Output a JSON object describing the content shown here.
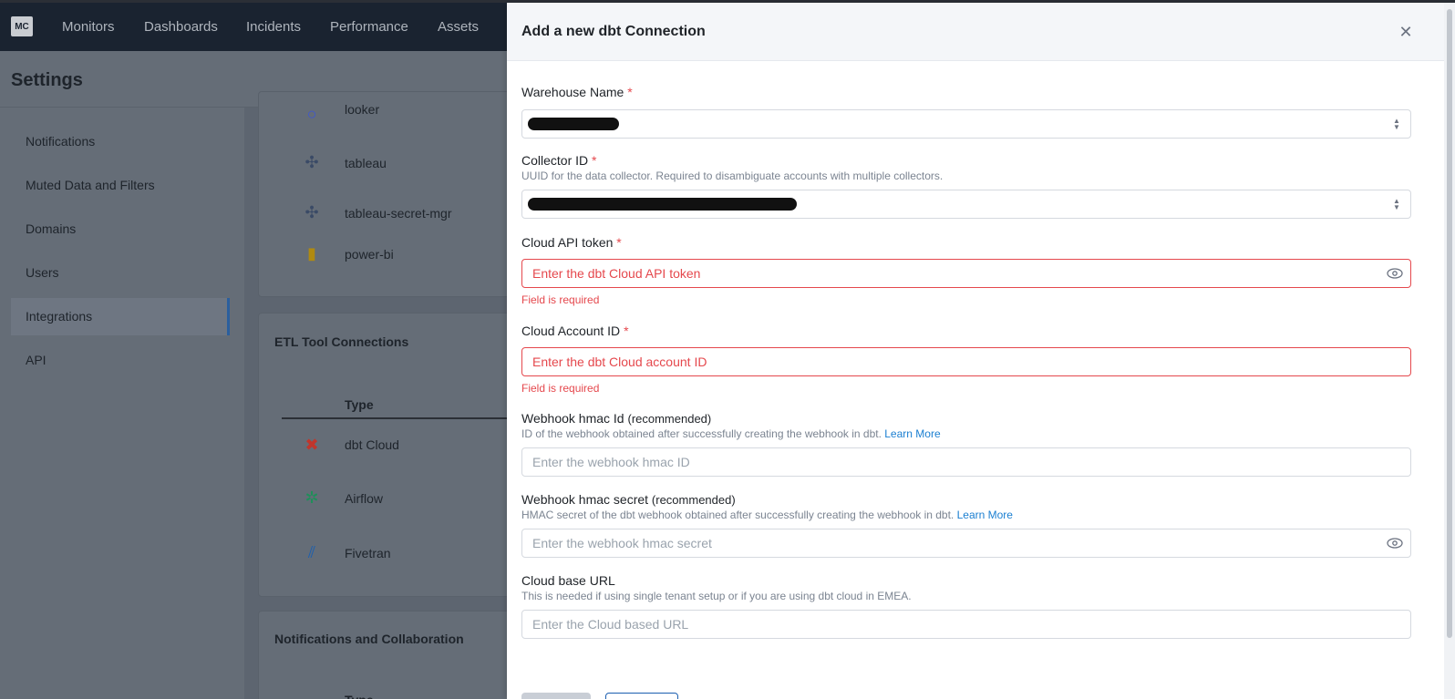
{
  "app": {
    "logo": "MC",
    "nav": [
      "Monitors",
      "Dashboards",
      "Incidents",
      "Performance",
      "Assets"
    ],
    "page_title": "Settings"
  },
  "sidebar": {
    "items": [
      "Notifications",
      "Muted Data and Filters",
      "Domains",
      "Users",
      "Integrations",
      "API"
    ],
    "active": "Integrations"
  },
  "bi_rows": [
    {
      "name": "looker",
      "icon": "looker-icon"
    },
    {
      "name": "tableau",
      "icon": "tableau-icon"
    },
    {
      "name": "tableau-secret-mgr",
      "icon": "tableau-icon"
    },
    {
      "name": "power-bi",
      "icon": "power-bi-icon"
    }
  ],
  "etl": {
    "title": "ETL Tool Connections",
    "column_type": "Type",
    "rows": [
      {
        "name": "dbt Cloud",
        "icon": "dbt-icon"
      },
      {
        "name": "Airflow",
        "icon": "airflow-icon"
      },
      {
        "name": "Fivetran",
        "icon": "fivetran-icon"
      }
    ]
  },
  "notifications_section": {
    "title": "Notifications and Collaboration",
    "column_type": "Type"
  },
  "drawer": {
    "title": "Add a new dbt Connection",
    "warehouse": {
      "label": "Warehouse Name",
      "required": "*"
    },
    "collector": {
      "label": "Collector ID",
      "required": "*",
      "help": "UUID for the data collector. Required to disambiguate accounts with multiple collectors."
    },
    "api_token": {
      "label": "Cloud API token",
      "required": "*",
      "placeholder": "Enter the dbt Cloud API token",
      "error": "Field is required"
    },
    "account_id": {
      "label": "Cloud Account ID",
      "required": "*",
      "placeholder": "Enter the dbt Cloud account ID",
      "error": "Field is required"
    },
    "hmac_id": {
      "label": "Webhook hmac Id",
      "tag": "(recommended)",
      "help": "ID of the webhook obtained after successfully creating the webhook in dbt.",
      "link": "Learn More",
      "placeholder": "Enter the webhook hmac ID"
    },
    "hmac_secret": {
      "label": "Webhook hmac secret",
      "tag": "(recommended)",
      "help": "HMAC secret of the dbt webhook obtained after successfully creating the webhook in dbt.",
      "link": "Learn More",
      "placeholder": "Enter the webhook hmac secret"
    },
    "base_url": {
      "label": "Cloud base URL",
      "help": "This is needed if using single tenant setup or if you are using dbt cloud in EMEA.",
      "placeholder": "Enter the Cloud based URL"
    }
  },
  "colors": {
    "accent": "#1b7fd1",
    "error": "#e5484d",
    "nav_bg": "#1a2330"
  }
}
